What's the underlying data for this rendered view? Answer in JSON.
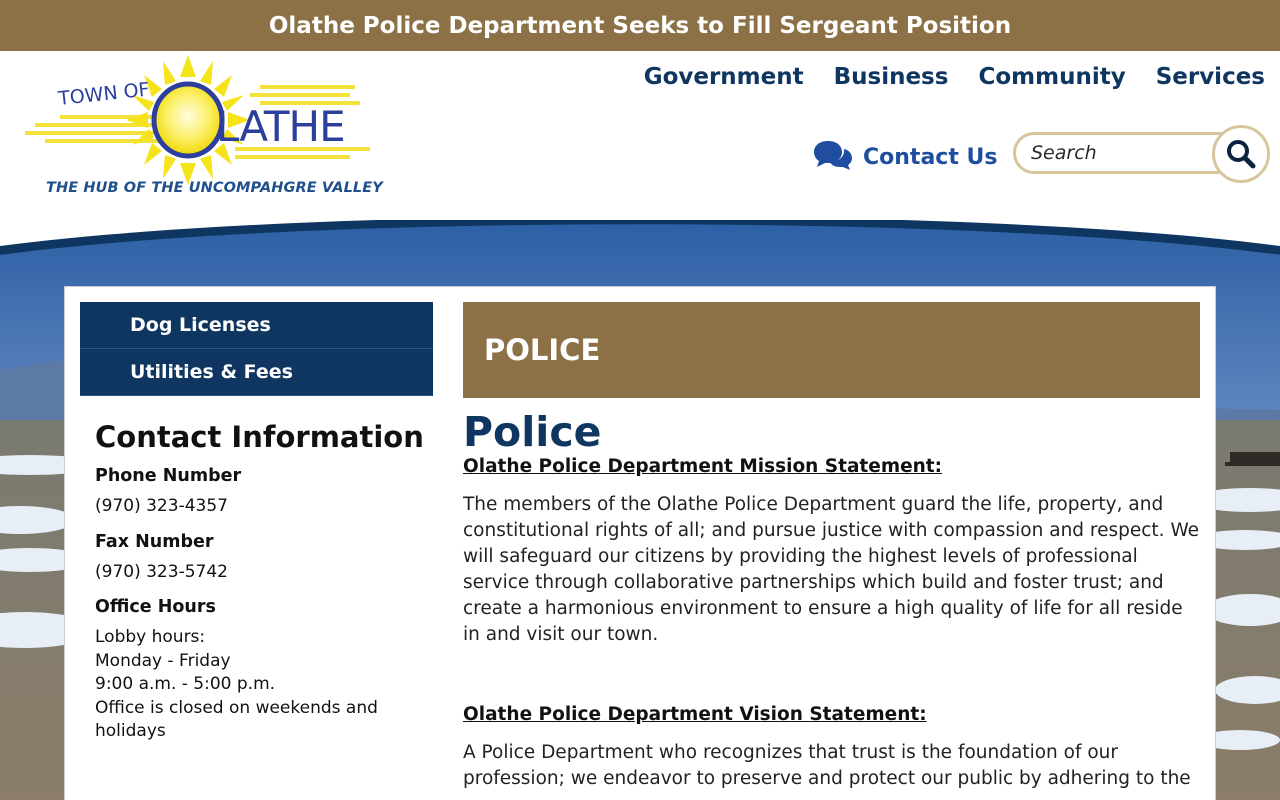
{
  "alert": {
    "text": "Olathe Police Department Seeks to Fill Sergeant Position"
  },
  "logo": {
    "town_of": "TOWN OF",
    "name": "OLATHE",
    "tagline": "THE HUB OF THE UNCOMPAHGRE VALLEY"
  },
  "nav": {
    "items": [
      "Government",
      "Business",
      "Community",
      "Services"
    ]
  },
  "contact_link": {
    "label": "Contact Us",
    "icon": "chat-bubbles-icon"
  },
  "search": {
    "placeholder": "Search",
    "icon": "search-icon"
  },
  "side_menu": {
    "items": [
      "Dog Licenses",
      "Utilities & Fees"
    ]
  },
  "contact_info": {
    "title": "Contact Information",
    "phone_label": "Phone Number",
    "phone": "(970) 323-4357",
    "fax_label": "Fax Number",
    "fax": "(970) 323-5742",
    "hours_label": "Office Hours",
    "hours": [
      "Lobby hours:",
      "Monday - Friday",
      "9:00 a.m. - 5:00 p.m.",
      "Office is closed on weekends and holidays"
    ]
  },
  "page": {
    "banner": "POLICE",
    "title": "Police",
    "mission_heading": "Olathe Police Department Mission Statement:",
    "mission_text": "The members of the Olathe Police Department guard the life, property, and constitutional rights of all; and pursue justice with compassion and respect. We will safeguard our citizens by providing the highest levels of professional service through collaborative partnerships which build and foster trust; and create a harmonious environment to ensure a high quality of life for all reside in and visit our town.",
    "vision_heading": "Olathe Police Department Vision Statement:",
    "vision_text": "A Police Department who recognizes that trust is the foundation of our profession; we endeavor to preserve and protect our public by adhering to the"
  },
  "colors": {
    "brand_gold": "#8b7145",
    "navy": "#0e3661",
    "link_blue": "#1f4ea0"
  }
}
